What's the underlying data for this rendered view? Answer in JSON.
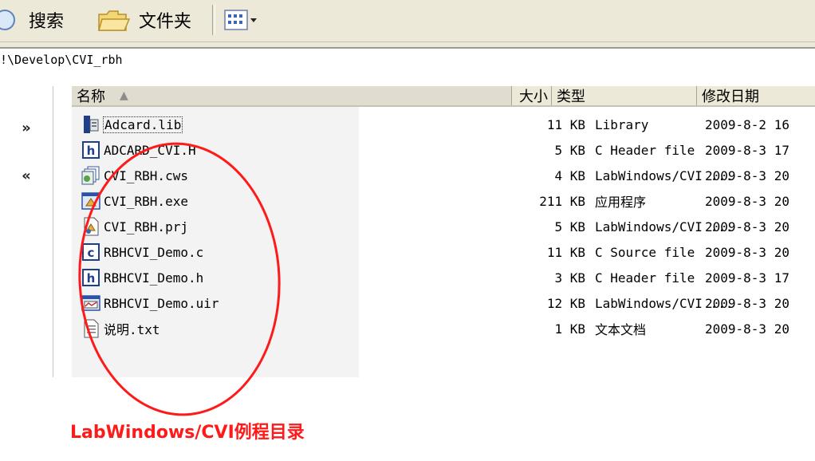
{
  "toolbar": {
    "search_label": "搜索",
    "folders_label": "文件夹"
  },
  "address": "!\\Develop\\CVI_rbh",
  "columns": {
    "name": "名称",
    "size": "大小",
    "type": "类型",
    "date": "修改日期"
  },
  "files": [
    {
      "name": "Adcard.lib",
      "size": "11 KB",
      "type": "Library",
      "date": "2009-8-2 16",
      "icon": "library-file-icon"
    },
    {
      "name": "ADCARD_CVI.H",
      "size": "5 KB",
      "type": "C Header file",
      "date": "2009-8-3 17",
      "icon": "header-file-icon"
    },
    {
      "name": "CVI_RBH.cws",
      "size": "4 KB",
      "type": "LabWindows/CVI ...",
      "date": "2009-8-3 20",
      "icon": "workspace-file-icon"
    },
    {
      "name": "CVI_RBH.exe",
      "size": "211 KB",
      "type": "应用程序",
      "date": "2009-8-3 20",
      "icon": "executable-file-icon"
    },
    {
      "name": "CVI_RBH.prj",
      "size": "5 KB",
      "type": "LabWindows/CVI ...",
      "date": "2009-8-3 20",
      "icon": "project-file-icon"
    },
    {
      "name": "RBHCVI_Demo.c",
      "size": "11 KB",
      "type": "C Source file",
      "date": "2009-8-3 20",
      "icon": "c-source-file-icon"
    },
    {
      "name": "RBHCVI_Demo.h",
      "size": "3 KB",
      "type": "C Header file",
      "date": "2009-8-3 17",
      "icon": "header-file-icon"
    },
    {
      "name": "RBHCVI_Demo.uir",
      "size": "12 KB",
      "type": "LabWindows/CVI ...",
      "date": "2009-8-3 20",
      "icon": "uir-file-icon"
    },
    {
      "name": "说明.txt",
      "size": "1 KB",
      "type": "文本文档",
      "date": "2009-8-3 20",
      "icon": "text-file-icon"
    }
  ],
  "annotation": "LabWindows/CVI例程目录",
  "colors": {
    "annotation": "#ff1a1a",
    "toolbar_bg": "#ece9d8"
  }
}
